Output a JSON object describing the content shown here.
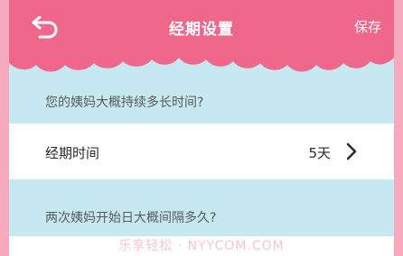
{
  "header": {
    "title": "经期设置",
    "save_label": "保存",
    "back_icon": "back-arrow-icon"
  },
  "section1": {
    "question": "您的姨妈大概持续多长时间?"
  },
  "period_row": {
    "label": "经期时间",
    "value": "5天",
    "chevron_icon": "chevron-right-icon"
  },
  "section2": {
    "question": "两次姨妈开始日大概间隔多久?"
  },
  "watermark": "乐享轻松 · NYYCOM.COM",
  "colors": {
    "header": "#f0678c",
    "section_bg": "#c5e8f1",
    "page_bg": "#f7a9bd"
  }
}
